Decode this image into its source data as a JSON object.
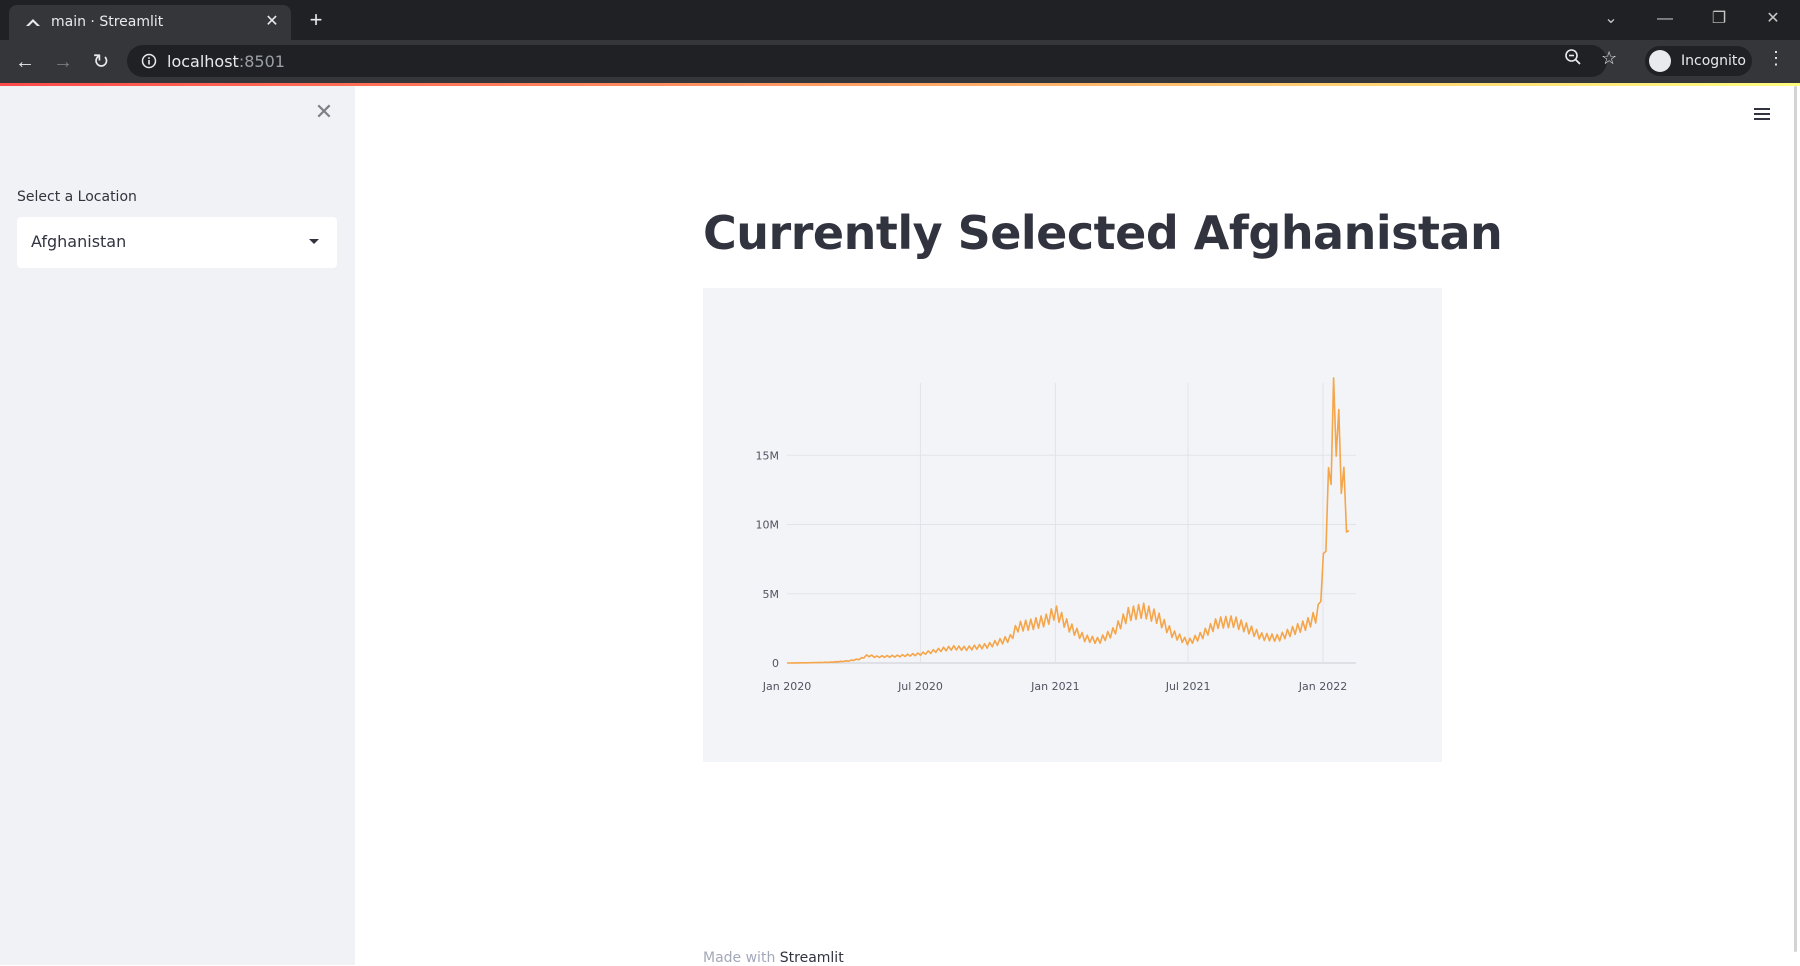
{
  "browser": {
    "tab_title": "main · Streamlit",
    "url_host": "localhost",
    "url_port": ":8501",
    "profile_label": "Incognito"
  },
  "sidebar": {
    "select_label": "Select a Location",
    "select_value": "Afghanistan"
  },
  "main": {
    "title": "Currently Selected Afghanistan"
  },
  "footer": {
    "prefix": "Made with ",
    "link": "Streamlit"
  },
  "colors": {
    "line": "#f5a54a",
    "accent": "#ff4b4b",
    "text": "#31333f"
  },
  "chart_data": {
    "type": "line",
    "title": "",
    "xlabel": "",
    "ylabel": "",
    "x_ticks": [
      "Jan 2020",
      "Jul 2020",
      "Jan 2021",
      "Jul 2021",
      "Jan 2022"
    ],
    "y_ticks": [
      "0",
      "5M",
      "10M",
      "15M"
    ],
    "ylim": [
      0,
      19500000
    ],
    "xlim": [
      "2020-01-01",
      "2022-02-15"
    ],
    "grid": true,
    "series": [
      {
        "color": "#f5a54a",
        "points": [
          [
            "2020-01-01",
            0
          ],
          [
            "2020-02-01",
            20000
          ],
          [
            "2020-03-01",
            60000
          ],
          [
            "2020-03-25",
            150000
          ],
          [
            "2020-04-10",
            300000
          ],
          [
            "2020-04-20",
            550000
          ],
          [
            "2020-05-01",
            450000
          ],
          [
            "2020-06-01",
            500000
          ],
          [
            "2020-07-01",
            650000
          ],
          [
            "2020-08-01",
            1000000
          ],
          [
            "2020-08-15",
            1100000
          ],
          [
            "2020-09-01",
            1050000
          ],
          [
            "2020-10-01",
            1250000
          ],
          [
            "2020-11-01",
            1800000
          ],
          [
            "2020-11-10",
            2600000
          ],
          [
            "2020-12-01",
            2800000
          ],
          [
            "2020-12-20",
            3100000
          ],
          [
            "2021-01-01",
            3700000
          ],
          [
            "2021-01-20",
            2600000
          ],
          [
            "2021-02-10",
            1800000
          ],
          [
            "2021-03-01",
            1600000
          ],
          [
            "2021-03-20",
            2200000
          ],
          [
            "2021-04-10",
            3500000
          ],
          [
            "2021-05-01",
            3800000
          ],
          [
            "2021-05-20",
            3300000
          ],
          [
            "2021-06-10",
            2100000
          ],
          [
            "2021-07-01",
            1500000
          ],
          [
            "2021-07-20",
            2000000
          ],
          [
            "2021-08-10",
            2900000
          ],
          [
            "2021-09-01",
            3000000
          ],
          [
            "2021-09-20",
            2500000
          ],
          [
            "2021-10-10",
            1900000
          ],
          [
            "2021-11-01",
            1800000
          ],
          [
            "2021-11-20",
            2300000
          ],
          [
            "2021-12-10",
            2800000
          ],
          [
            "2021-12-25",
            3500000
          ],
          [
            "2021-12-31",
            6000000
          ],
          [
            "2022-01-04",
            8500000
          ],
          [
            "2022-01-08",
            12000000
          ],
          [
            "2022-01-12",
            15000000
          ],
          [
            "2022-01-16",
            18500000
          ],
          [
            "2022-01-20",
            17000000
          ],
          [
            "2022-01-24",
            15500000
          ],
          [
            "2022-01-28",
            13000000
          ],
          [
            "2022-02-02",
            11000000
          ],
          [
            "2022-02-06",
            8000000
          ]
        ]
      }
    ]
  }
}
